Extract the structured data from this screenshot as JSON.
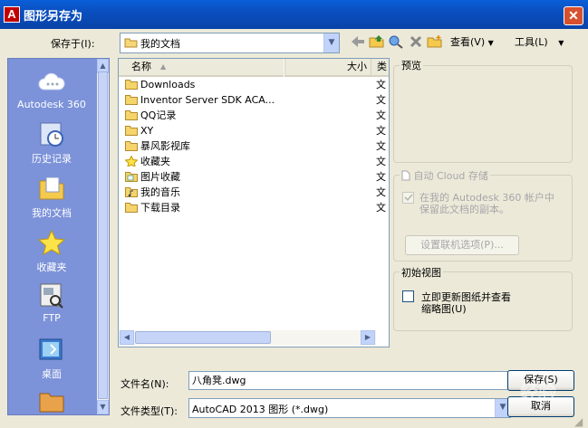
{
  "window": {
    "title": "图形另存为",
    "app_icon_letter": "A",
    "close_glyph": "✕"
  },
  "toolbar": {
    "save_in_label": "保存于(I):",
    "save_in_value": "我的文档",
    "views_label": "查看(V)",
    "tools_label": "工具(L)",
    "dropdown_glyph": "▼"
  },
  "places": [
    {
      "label": "Autodesk 360",
      "icon": "cloud-icon"
    },
    {
      "label": "历史记录",
      "icon": "history-icon"
    },
    {
      "label": "我的文档",
      "icon": "my-documents-icon"
    },
    {
      "label": "收藏夹",
      "icon": "favorites-star-icon"
    },
    {
      "label": "FTP",
      "icon": "ftp-icon"
    },
    {
      "label": "桌面",
      "icon": "desktop-icon"
    }
  ],
  "file_list": {
    "col_name": "名称",
    "col_size": "大小",
    "col_type": "类",
    "sort_glyph": "▲",
    "rows": [
      {
        "name": "Downloads",
        "type": "文",
        "icon": "folder-icon"
      },
      {
        "name": "Inventor Server SDK ACA...",
        "type": "文",
        "icon": "folder-icon"
      },
      {
        "name": "QQ记录",
        "type": "文",
        "icon": "folder-icon"
      },
      {
        "name": "XY",
        "type": "文",
        "icon": "folder-icon"
      },
      {
        "name": "暴风影视库",
        "type": "文",
        "icon": "folder-icon"
      },
      {
        "name": "收藏夹",
        "type": "文",
        "icon": "favorites-folder-icon"
      },
      {
        "name": "图片收藏",
        "type": "文",
        "icon": "pictures-folder-icon"
      },
      {
        "name": "我的音乐",
        "type": "文",
        "icon": "music-folder-icon"
      },
      {
        "name": "下载目录",
        "type": "文",
        "icon": "folder-icon"
      }
    ]
  },
  "preview": {
    "title": "预览"
  },
  "cloud": {
    "title": "自动 Cloud 存储",
    "line1": "在我的 Autodesk 360 帐户中",
    "line2": "保留此文档的副本。",
    "online_options_label": "设置联机选项(P)..."
  },
  "initial_view": {
    "title": "初始视图",
    "line1": "立即更新图纸并查看",
    "line2": "缩略图(U)"
  },
  "form": {
    "filename_label": "文件名(N):",
    "filename_value": "八角凳.dwg",
    "filetype_label": "文件类型(T):",
    "filetype_value": "AutoCAD 2013 图形 (*.dwg)",
    "save_label": "保存(S)",
    "cancel_label": "取消"
  },
  "watermark": "经验"
}
